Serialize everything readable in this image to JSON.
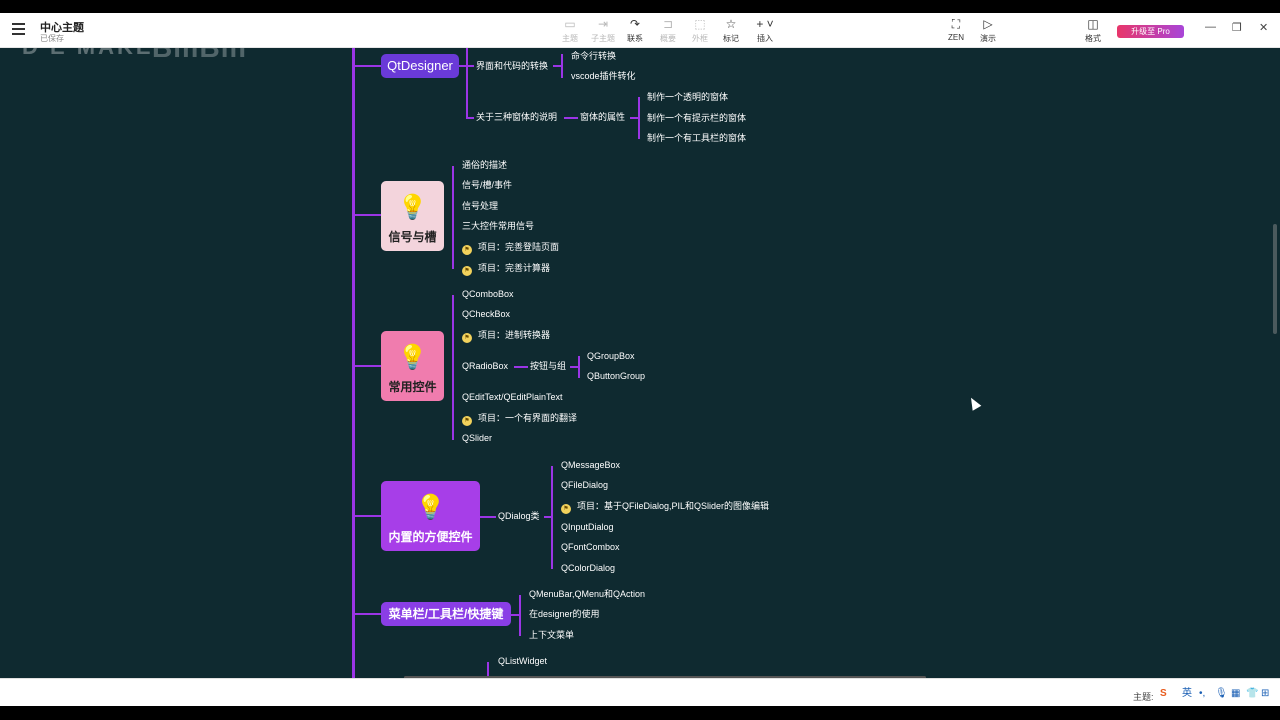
{
  "app": {
    "title": "中心主题",
    "subtitle": "已保存"
  },
  "toolbar": {
    "items": [
      {
        "label": "主题",
        "icon": "topic-icon",
        "disabled": true
      },
      {
        "label": "子主题",
        "icon": "subtopic-icon",
        "disabled": true
      },
      {
        "label": "联系",
        "icon": "relationship-icon",
        "disabled": false
      },
      {
        "label": "概要",
        "icon": "summary-icon",
        "disabled": true
      },
      {
        "label": "外框",
        "icon": "boundary-icon",
        "disabled": true
      },
      {
        "label": "标记",
        "icon": "star-icon",
        "disabled": false
      },
      {
        "label": "插入",
        "icon": "plus-icon",
        "disabled": false
      }
    ],
    "zen": "ZEN",
    "present": "演示",
    "format": "格式",
    "upgrade": "升级至 Pro"
  },
  "watermark": {
    "text1": "D E MAKE",
    "text2": "BiliBili"
  },
  "map": {
    "qtdesigner": {
      "label": "QtDesigner",
      "b1": "界面和代码的转换",
      "b1_children": [
        "命令行转换",
        "vscode插件转化"
      ],
      "b2": "关于三种窗体的说明",
      "b2_mid": "窗体的属性",
      "b2_children": [
        "制作一个透明的窗体",
        "制作一个有提示栏的窗体",
        "制作一个有工具栏的窗体"
      ]
    },
    "signals": {
      "label": "信号与槽",
      "children": [
        "通俗的描述",
        "信号/槽/事件",
        "信号处理",
        "三大控件常用信号",
        "项目：完善登陆页面",
        "项目：完善计算器"
      ]
    },
    "widgets": {
      "label": "常用控件",
      "qcombobox": "QComboBox",
      "qcheckbox": "QCheckBox",
      "proj1": "项目：进制转换器",
      "qradiobox": "QRadioBox",
      "btngroup": "按钮与组",
      "btngroup_children": [
        "QGroupBox",
        "QButtonGroup"
      ],
      "qedit": "QEditText/QEditPlainText",
      "proj2": "项目：一个有界面的翻译",
      "qslider": "QSlider"
    },
    "builtin": {
      "label": "内置的方便控件",
      "mid": "QDialog类",
      "children": [
        "QMessageBox",
        "QFileDialog",
        "项目：基于QFileDialog,PIL和QSlider的图像编辑",
        "QInputDialog",
        "QFontCombox",
        "QColorDialog"
      ]
    },
    "menus": {
      "label": "菜单栏/工具栏/快捷键",
      "children": [
        "QMenuBar,QMenu和QAction",
        "在designer的使用",
        "上下文菜单"
      ]
    },
    "next": {
      "child": "QListWidget"
    }
  },
  "statusbar": {
    "theme": "主题:",
    "ime": "英"
  },
  "colors": {
    "canvas": "#0f2a30",
    "branch": "#9b35e6",
    "topic_qtdesigner": "#6a3ad8",
    "topic_signals": "#f3d4dc",
    "topic_widgets": "#f07cae",
    "topic_builtin": "#a73ee8",
    "topic_menus": "#8a3ee6",
    "project_marker": "#f2d25c"
  }
}
